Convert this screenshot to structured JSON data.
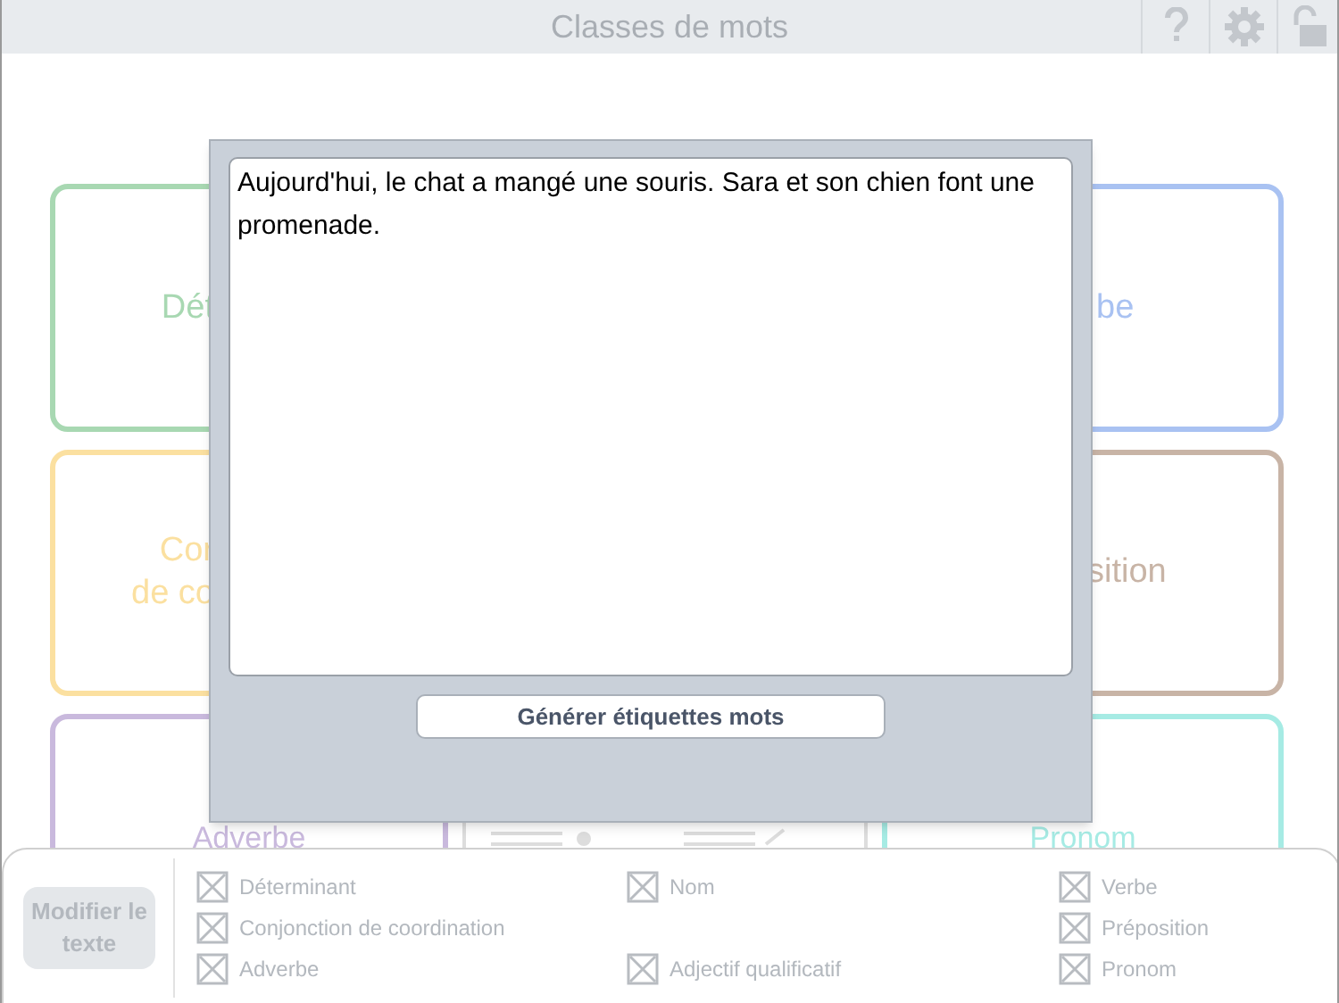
{
  "header": {
    "title": "Classes de mots"
  },
  "cards": [
    {
      "text": "Dét",
      "color": "#a8d8b2"
    },
    {
      "text": "be",
      "color": "#a9c2f2"
    },
    {
      "text": "Cor\nde co",
      "color": "#fbe0a0"
    },
    {
      "text": "sition",
      "color": "#c8b4a6"
    },
    {
      "text": "Adverbe",
      "color": "#c9b9dd"
    },
    {
      "text": "Pronom",
      "color": "#a6ebe4"
    }
  ],
  "dialog": {
    "text": "Aujourd'hui, le chat a mangé une souris. Sara et son chien font une promenade.",
    "button": "Générer étiquettes mots"
  },
  "bottom_bar": {
    "edit_button": "Modifier le texte",
    "filter_rows": [
      [
        {
          "label": "Déterminant",
          "checked": true
        },
        {
          "label": "Nom",
          "checked": true
        },
        {
          "label": "Verbe",
          "checked": true
        }
      ],
      [
        {
          "label": "Conjonction de coordination",
          "checked": true
        },
        {
          "label": "Préposition",
          "checked": true
        }
      ],
      [
        {
          "label": "Adverbe",
          "checked": true
        },
        {
          "label": "Adjectif qualificatif",
          "checked": true
        },
        {
          "label": "Pronom",
          "checked": true
        }
      ]
    ]
  }
}
